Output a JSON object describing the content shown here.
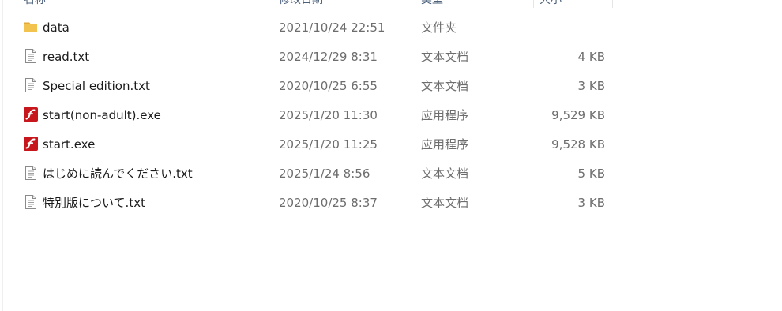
{
  "columns": {
    "name": "名称",
    "date": "修改日期",
    "type": "类型",
    "size": "大小"
  },
  "files": [
    {
      "name": "data",
      "date": "2021/10/24 22:51",
      "type": "文件夹",
      "size": "",
      "icon": "folder-icon"
    },
    {
      "name": "read.txt",
      "date": "2024/12/29 8:31",
      "type": "文本文档",
      "size": "4 KB",
      "icon": "text-file-icon"
    },
    {
      "name": "Special edition.txt",
      "date": "2020/10/25 6:55",
      "type": "文本文档",
      "size": "3 KB",
      "icon": "text-file-icon"
    },
    {
      "name": "start(non-adult).exe",
      "date": "2025/1/20 11:30",
      "type": "应用程序",
      "size": "9,529 KB",
      "icon": "flash-app-icon"
    },
    {
      "name": "start.exe",
      "date": "2025/1/20 11:25",
      "type": "应用程序",
      "size": "9,528 KB",
      "icon": "flash-app-icon"
    },
    {
      "name": "はじめに読んでください.txt",
      "date": "2025/1/24 8:56",
      "type": "文本文档",
      "size": "5 KB",
      "icon": "text-file-icon"
    },
    {
      "name": "特別版について.txt",
      "date": "2020/10/25 8:37",
      "type": "文本文档",
      "size": "3 KB",
      "icon": "text-file-icon"
    }
  ],
  "colors": {
    "folder": "#f3c34f",
    "folder_dark": "#e2a93a",
    "flash_red": "#c8161d",
    "text_primary": "#1a1a1a",
    "text_secondary": "#6d6d6d"
  }
}
